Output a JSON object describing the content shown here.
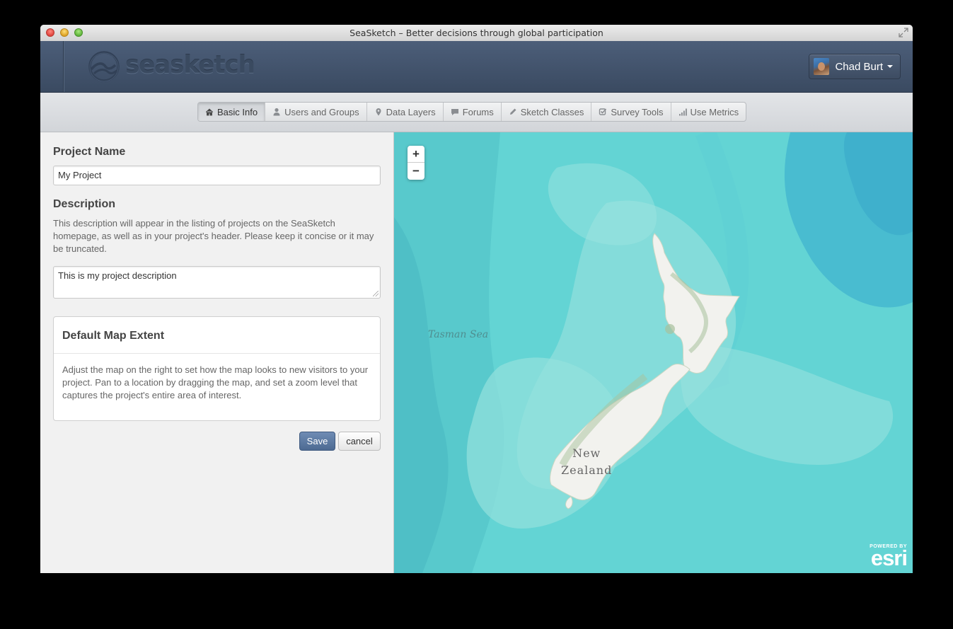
{
  "window": {
    "title": "SeaSketch – Better decisions through global participation"
  },
  "header": {
    "logo_text": "seasketch",
    "user_name": "Chad Burt"
  },
  "tabs": [
    {
      "label": "Basic Info",
      "icon": "home-icon",
      "active": true
    },
    {
      "label": "Users and Groups",
      "icon": "user-icon",
      "active": false
    },
    {
      "label": "Data Layers",
      "icon": "map-marker-icon",
      "active": false
    },
    {
      "label": "Forums",
      "icon": "comment-icon",
      "active": false
    },
    {
      "label": "Sketch Classes",
      "icon": "pencil-icon",
      "active": false
    },
    {
      "label": "Survey Tools",
      "icon": "check-icon",
      "active": false
    },
    {
      "label": "Use Metrics",
      "icon": "signal-icon",
      "active": false
    }
  ],
  "form": {
    "project_name_label": "Project Name",
    "project_name_value": "My Project",
    "description_label": "Description",
    "description_help": "This description will appear in the listing of projects on the SeaSketch homepage, as well as in your project's header. Please keep it concise or it may be truncated.",
    "description_value": "This is my project description",
    "extent_title": "Default Map Extent",
    "extent_help": "Adjust the map on the right to set how the map looks to new visitors to your project. Pan to a location by dragging the map, and set a zoom level that captures the project's entire area of interest.",
    "save_label": "Save",
    "cancel_label": "cancel"
  },
  "map": {
    "zoom_in": "+",
    "zoom_out": "−",
    "sea_label": "Tasman Sea",
    "country_label_line1": "New",
    "country_label_line2": "Zealand",
    "attribution_small": "POWERED BY",
    "attribution_brand": "esri"
  }
}
